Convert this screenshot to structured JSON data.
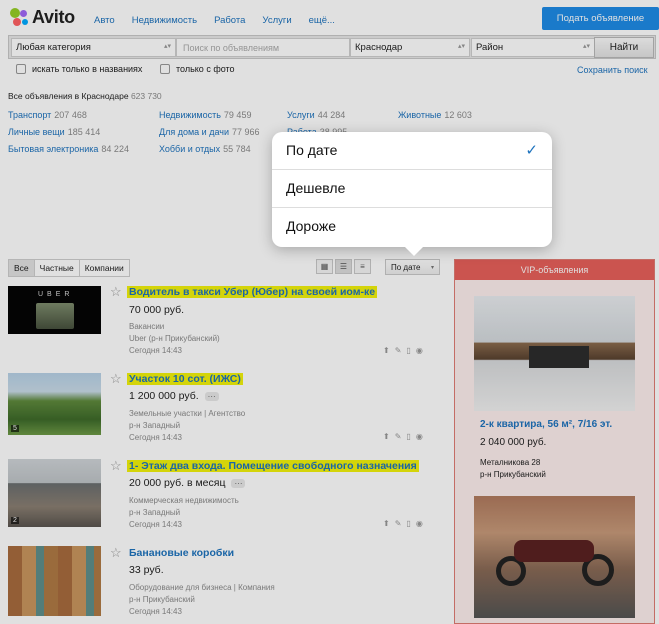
{
  "header": {
    "logo_text": "Avito",
    "logo_colors": [
      "#97cf26",
      "#a169f7",
      "#ff6163",
      "#0af"
    ],
    "nav": [
      "Авто",
      "Недвижимость",
      "Работа",
      "Услуги",
      "ещё..."
    ],
    "post_button": "Подать объявление"
  },
  "search": {
    "category": "Любая категория",
    "query_placeholder": "Поиск по объявлениям",
    "city": "Краснодар",
    "district": "Район",
    "submit": "Найти",
    "only_titles": "искать только в названиях",
    "only_photo": "только с фото",
    "save_search": "Сохранить поиск"
  },
  "summary": {
    "label": "Все объявления в Краснодаре",
    "count": "623 730"
  },
  "categories": [
    {
      "name": "Транспорт",
      "count": "207 468"
    },
    {
      "name": "Недвижимость",
      "count": "79 459"
    },
    {
      "name": "Услуги",
      "count": "44 284"
    },
    {
      "name": "Животные",
      "count": "12 603"
    },
    {
      "name": "Личные вещи",
      "count": "185 414"
    },
    {
      "name": "Для дома и дачи",
      "count": "77 966"
    },
    {
      "name": "Работа",
      "count": "38 995"
    },
    {
      "name": "Бытовая электроника",
      "count": "84 224"
    },
    {
      "name": "Хобби и отдых",
      "count": "55 784"
    }
  ],
  "tabs": [
    "Все",
    "Частные",
    "Компании"
  ],
  "sort": {
    "current": "По дате",
    "options": [
      "По дате",
      "Дешевле",
      "Дороже"
    ],
    "selected_mark": "✓"
  },
  "listings": [
    {
      "title": "Водитель в такси Убер (Юбер) на своей иом-ке",
      "price": "70 000 руб.",
      "category": "Вакансии",
      "location": "Uber (р-н Прикубанский)",
      "date": "Сегодня 14:43",
      "photo_label": "UBER",
      "photos": ""
    },
    {
      "title": "Участок 10 сот. (ИЖС)",
      "price": "1 200 000 руб.",
      "category": "Земельные участки",
      "seller": "Агентство",
      "location": "р-н Западный",
      "date": "Сегодня 14:43",
      "photos": "5"
    },
    {
      "title": "1- Этаж два входа. Помещение свободного назначения",
      "price": "20 000 руб. в месяц",
      "category": "Коммерческая недвижимость",
      "location": "р-н Западный",
      "date": "Сегодня 14:43",
      "photos": "2"
    },
    {
      "title": "Банановые коробки",
      "price": "33 руб.",
      "category": "Оборудование для бизнеса",
      "seller": "Компания",
      "location": "р-н Прикубанский",
      "date": "Сегодня 14:43",
      "photos": ""
    }
  ],
  "vip": {
    "heading": "VIP-объявления",
    "items": [
      {
        "title": "2-к квартира, 56 м², 7/16 эт.",
        "price": "2 040 000 руб.",
        "address": "Металникова 28",
        "district": "р-н Прикубанский"
      },
      {
        "title": "",
        "price": "",
        "address": "",
        "district": ""
      }
    ]
  },
  "icons": [
    "up-icon",
    "note-icon",
    "fav-icon",
    "info-icon"
  ]
}
